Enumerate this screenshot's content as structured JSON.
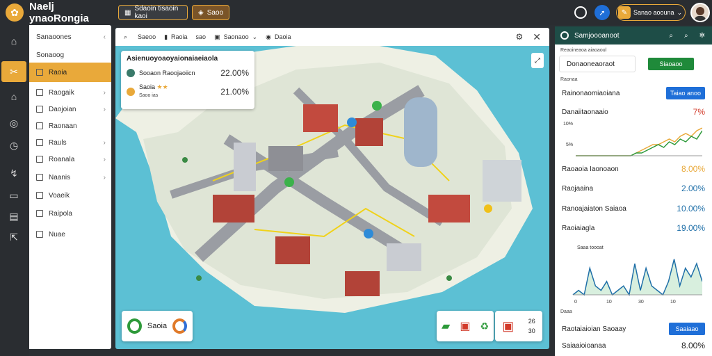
{
  "app": {
    "title": "Naelj ynaoRongia"
  },
  "topbar": {
    "button1": "Sdaoin tisaoin kaoi",
    "button2": "Saoo",
    "user_label": "Sanao aoouna"
  },
  "sidebar": {
    "header": "Sanaoones",
    "section": "Sonaoog",
    "items": [
      {
        "label": "Raoia",
        "chev": ""
      },
      {
        "label": "Raogaik",
        "chev": "›"
      },
      {
        "label": "Daojoian",
        "chev": "›"
      },
      {
        "label": "Raonaan",
        "chev": ""
      },
      {
        "label": "Rauls",
        "chev": "›"
      },
      {
        "label": "Roanala",
        "chev": "›"
      },
      {
        "label": "Naanis",
        "chev": "›"
      },
      {
        "label": "Voaeik",
        "chev": ""
      },
      {
        "label": "Raipola",
        "chev": ""
      },
      {
        "label": "Nuae",
        "chev": ""
      }
    ]
  },
  "map": {
    "toolbar": {
      "search": "Saeoo",
      "item2": "Raoia",
      "item3": "sao",
      "item4": "Saonaoo",
      "item5": "Daoia"
    },
    "stats": {
      "title": "Asienuoyoaoyaionaiaeiaola",
      "rows": [
        {
          "label": "Sooaon Raoojaoiicn",
          "value": "22.00%",
          "color": "#3a7a6a"
        },
        {
          "label": "Saoia",
          "sub": "Saoo ias",
          "value": "21.00%",
          "color": "#e9a93a"
        }
      ]
    },
    "legend1": {
      "label": "Saoia"
    },
    "legend3": {
      "v1": "26",
      "v2": "30"
    }
  },
  "right": {
    "header": "Samjoooanoot",
    "sub": "Reaoineaoa aiaoaoul",
    "input_value": "Donaoneaoraot",
    "green_btn": "Siaoaoo",
    "section_small": "Raonaa",
    "rows": [
      {
        "label": "Rainonaomiaoiana",
        "value": "",
        "btn": "Taiao anoo"
      },
      {
        "label": "Danaiitaonaaio",
        "value": "7%",
        "color": "#d23a2a"
      },
      {
        "label": "Raoaoia Iaonoaon",
        "value": "8.00%",
        "color": "#e9a93a"
      },
      {
        "label": "Raojaaina",
        "value": "2.00%",
        "color": "#1f6fa8"
      },
      {
        "label": "Ranoajaiaton Saiaoa",
        "value": "10.00%",
        "color": "#1f6fa8"
      },
      {
        "label": "Raoiaiagla",
        "value": "19.00%",
        "color": "#1f6fa8"
      }
    ],
    "chart1_labels": {
      "y1": "10%",
      "y2": "5%"
    },
    "chart2_labels": {
      "title": "Saaa toooat",
      "x": [
        "0",
        "10",
        "30",
        "10"
      ]
    },
    "bottom": {
      "small": "Daaa",
      "row1": "Raotaiaioian Saoaay",
      "btn": "Saaiaao",
      "row2": "Saiaaioioanaa",
      "value2": "8.00%"
    }
  },
  "chart_data": [
    {
      "type": "line",
      "title": "Danaiitaonaaio",
      "series": [
        {
          "values": [
            0,
            0,
            0,
            0,
            0,
            0,
            0,
            0,
            0,
            0,
            0,
            1,
            2,
            3,
            4,
            4,
            5,
            6,
            5,
            7,
            8,
            7,
            9,
            10
          ]
        },
        {
          "values": [
            0,
            0,
            0,
            0,
            0,
            0,
            0,
            0,
            0,
            0,
            0,
            1,
            1,
            2,
            3,
            4,
            3,
            5,
            4,
            6,
            5,
            7,
            6,
            9
          ]
        }
      ],
      "ylim": [
        0,
        12
      ]
    },
    {
      "type": "area",
      "title": "Saaa toooat",
      "x": [
        "0",
        "10",
        "30",
        "10"
      ],
      "series": [
        {
          "values": [
            0,
            1,
            0,
            6,
            2,
            1,
            3,
            0,
            1,
            2,
            0,
            7,
            1,
            6,
            2,
            1,
            0,
            3,
            8,
            2,
            6,
            4,
            7,
            3
          ]
        }
      ],
      "ylim": [
        0,
        10
      ]
    }
  ]
}
